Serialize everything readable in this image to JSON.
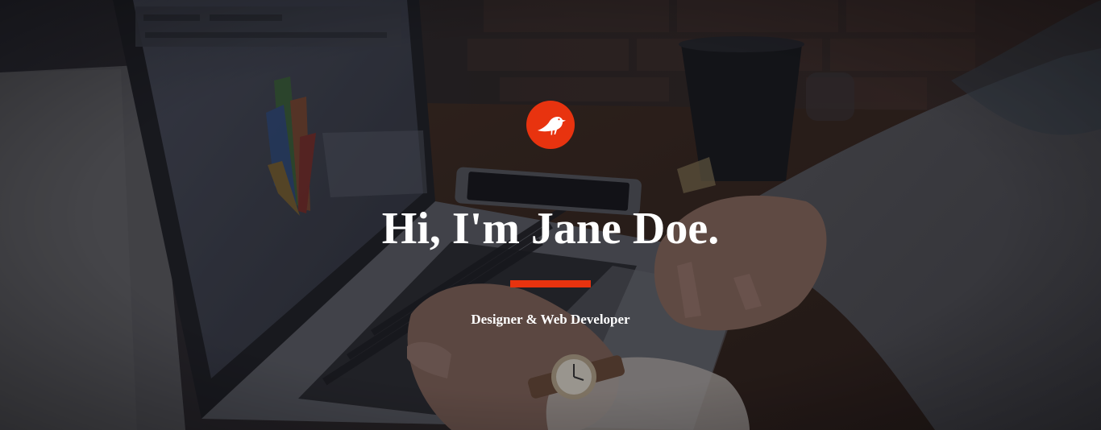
{
  "hero": {
    "logo_icon": "bird-icon",
    "headline": "Hi, I'm Jane Doe.",
    "tagline": "Designer & Web Developer"
  },
  "colors": {
    "accent": "#e8330f",
    "text": "#ffffff"
  }
}
